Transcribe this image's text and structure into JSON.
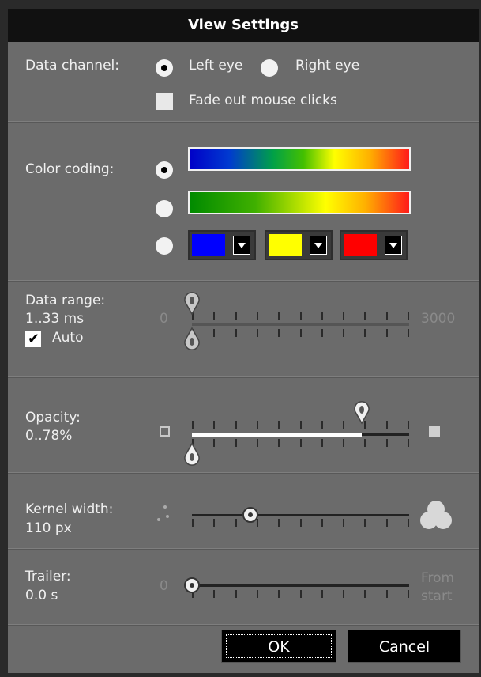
{
  "dialog": {
    "title": "View Settings"
  },
  "data_channel": {
    "label": "Data channel:",
    "options": [
      "Left eye",
      "Right eye"
    ],
    "selected": "Left eye",
    "fade_label": "Fade out mouse clicks",
    "fade_checked": false
  },
  "color_coding": {
    "label": "Color coding:",
    "selected_index": 0,
    "swatches": [
      "#0000ff",
      "#ffff00",
      "#ff0000"
    ]
  },
  "data_range": {
    "label": "Data range:",
    "value": "1..33 ms",
    "min_label": "0",
    "max_label": "3000",
    "auto_label": "Auto",
    "auto_checked": true
  },
  "opacity": {
    "label": "Opacity:",
    "value": "0..78%",
    "low": 0,
    "high": 0.78
  },
  "kernel": {
    "label": "Kernel width:",
    "value": "110 px",
    "level": 0.27
  },
  "trailer": {
    "label": "Trailer:",
    "value": "0.0 s",
    "min_label": "0",
    "max_label_1": "From",
    "max_label_2": "start",
    "level": 0
  },
  "buttons": {
    "ok": "OK",
    "cancel": "Cancel"
  }
}
